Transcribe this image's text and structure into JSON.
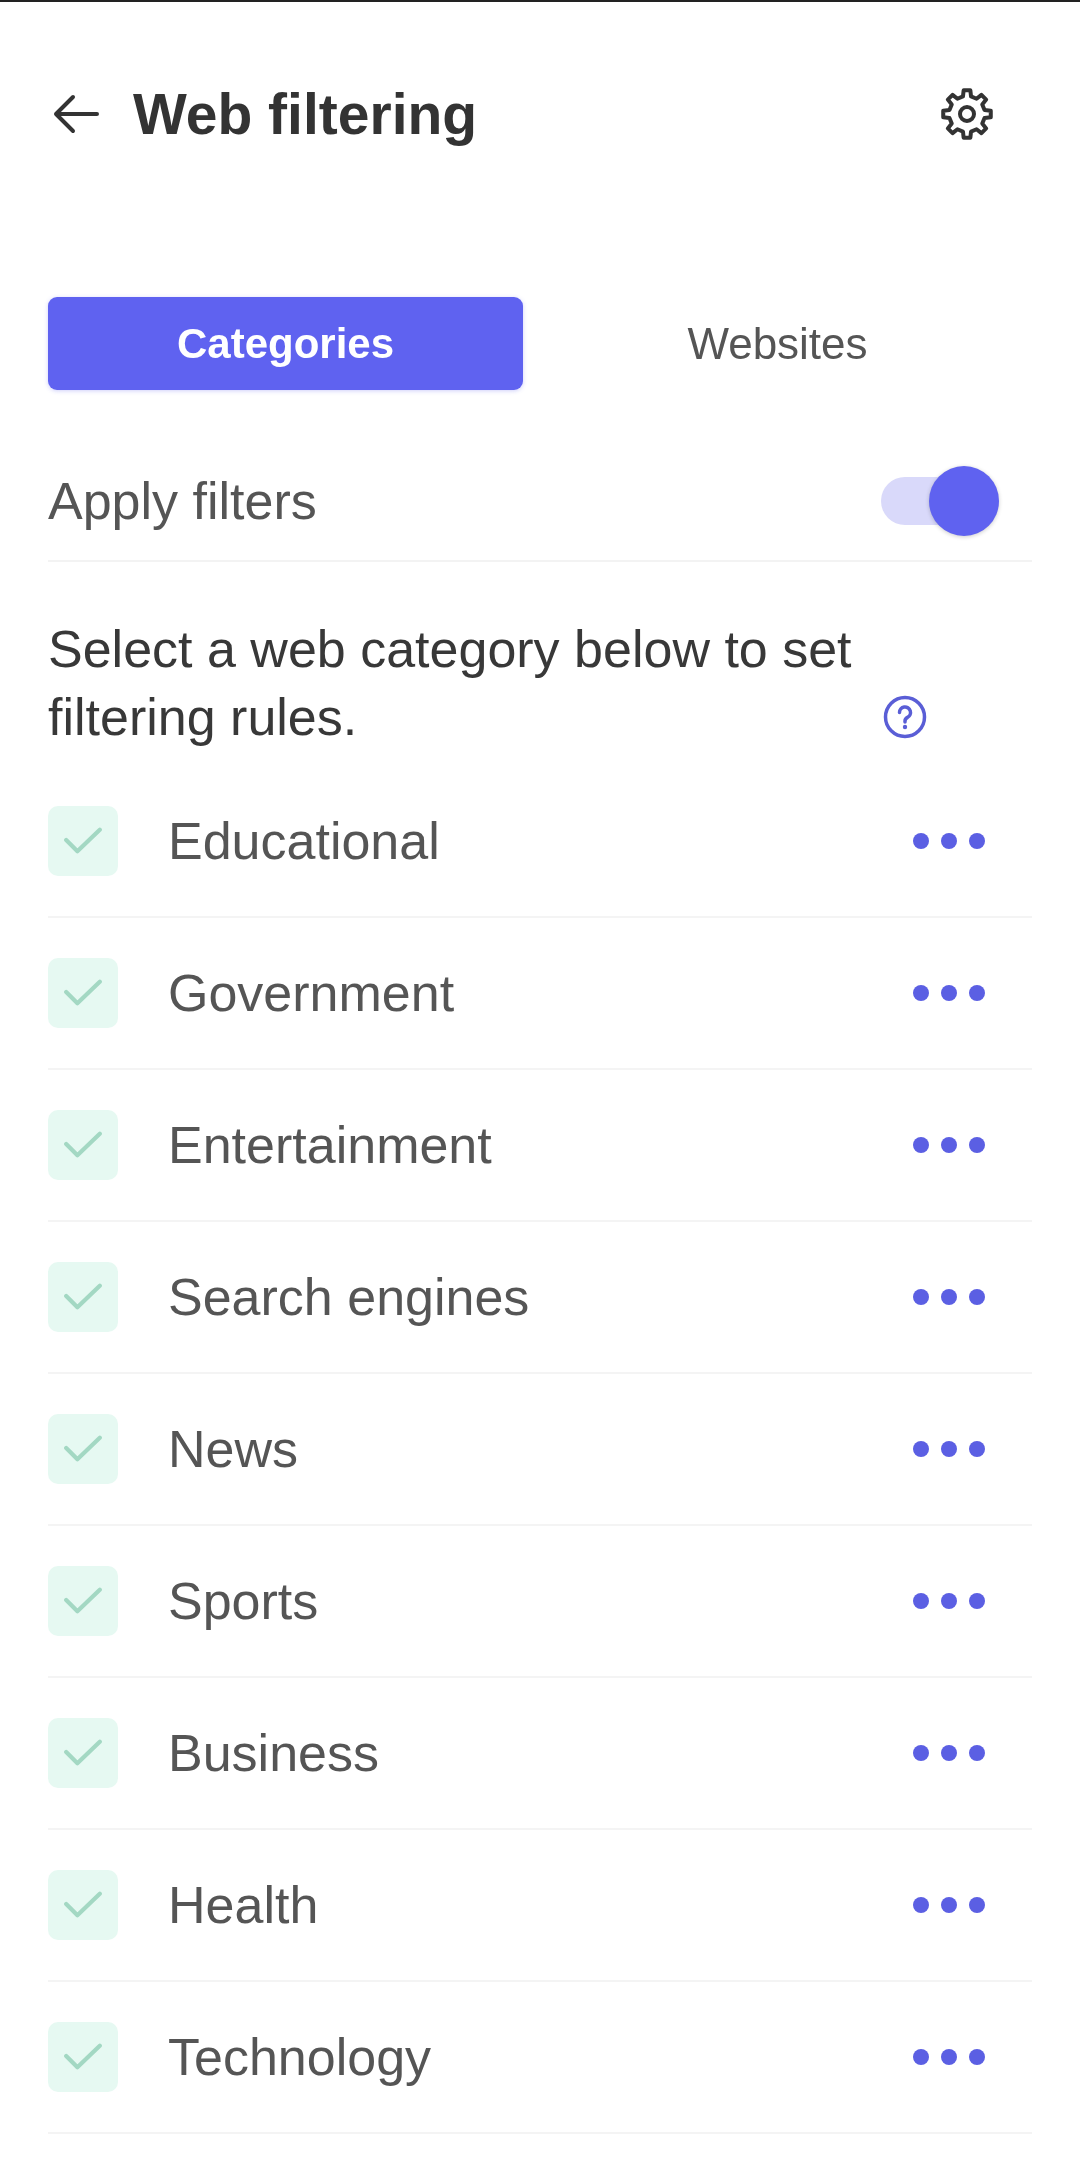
{
  "header": {
    "title": "Web filtering"
  },
  "tabs": [
    {
      "label": "Categories",
      "selected": true
    },
    {
      "label": "Websites",
      "selected": false
    }
  ],
  "apply_filters": {
    "label": "Apply filters",
    "on": true
  },
  "instruction": "Select a web category below to set filtering rules.",
  "categories": [
    {
      "label": "Educational",
      "checked": true
    },
    {
      "label": "Government",
      "checked": true
    },
    {
      "label": "Entertainment",
      "checked": true
    },
    {
      "label": "Search engines",
      "checked": true
    },
    {
      "label": "News",
      "checked": true
    },
    {
      "label": "Sports",
      "checked": true
    },
    {
      "label": "Business",
      "checked": true
    },
    {
      "label": "Health",
      "checked": true
    },
    {
      "label": "Technology",
      "checked": true
    }
  ]
}
